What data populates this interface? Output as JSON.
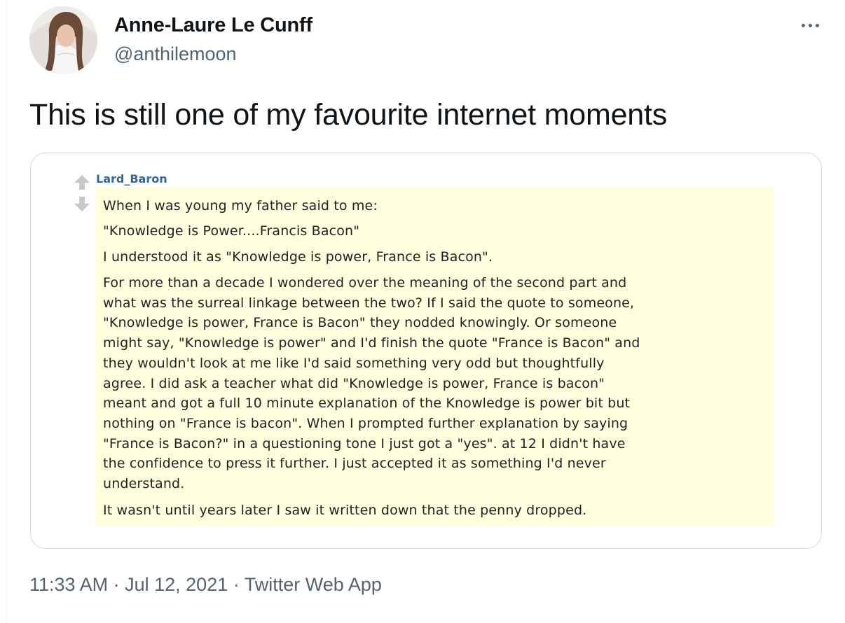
{
  "tweet": {
    "author_name": "Anne-Laure Le Cunff",
    "author_handle": "@anthilemoon",
    "text": "This is still one of my favourite internet moments",
    "time": "11:33 AM",
    "separator": "·",
    "date": "Jul 12, 2021",
    "source": "Twitter Web App",
    "more_icon": "more-horizontal-icon"
  },
  "media": {
    "comment_author": "Lard_Baron",
    "vote_icons": [
      "upvote-arrow-icon",
      "downvote-arrow-icon"
    ],
    "comment_bg_color": "#ffffe0",
    "author_color": "#336699",
    "paragraphs": [
      "When I was young my father said to me:",
      "\"Knowledge is Power....Francis Bacon\"",
      "I understood it as \"Knowledge is power, France is Bacon\".",
      "For more than a decade I wondered over the meaning of the second part and\nwhat was the surreal linkage between the two? If I said the quote to someone,\n\"Knowledge is power, France is Bacon\" they nodded knowingly. Or someone\nmight say, \"Knowledge is power\" and I'd finish the quote \"France is Bacon\" and\nthey wouldn't look at me like I'd said something very odd but thoughtfully\nagree. I did ask a teacher what did \"Knowledge is power, France is bacon\"\nmeant and got a full 10 minute explanation of the Knowledge is power bit but\nnothing on \"France is bacon\". When I prompted further explanation by saying\n\"France is Bacon?\" in a questioning tone I just got a \"yes\". at 12 I didn't have\nthe confidence to press it further. I just accepted it as something I'd never\nunderstand.",
      "It wasn't until years later I saw it written down that the penny dropped."
    ]
  },
  "colors": {
    "text_primary": "#0f1419",
    "text_secondary": "#536471",
    "card_border": "#cfd9de"
  }
}
